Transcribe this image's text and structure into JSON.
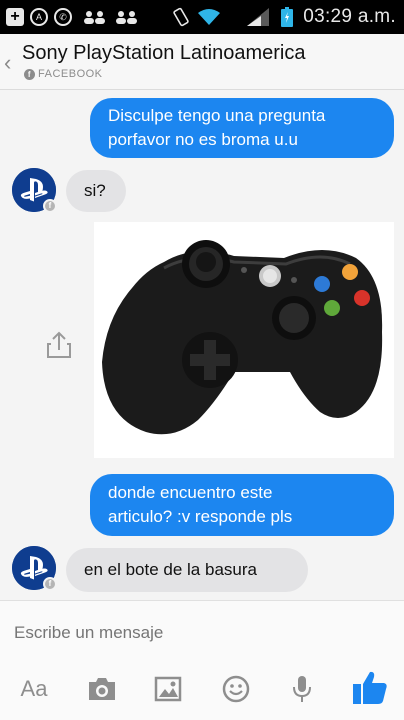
{
  "status_bar": {
    "time": "03:29 a.m."
  },
  "header": {
    "back_icon": "chevron-left-icon",
    "title": "Sony PlayStation Latinoamerica",
    "subtitle": "FACEBOOK"
  },
  "messages": [
    {
      "from": "me",
      "lines": [
        "Disculpe tengo una pregunta",
        "porfavor no es broma u.u"
      ]
    },
    {
      "from": "page",
      "lines": [
        "si?"
      ]
    },
    {
      "from": "me",
      "type": "image",
      "image": "xbox-360-controller-photo"
    },
    {
      "from": "me",
      "lines": [
        "donde encuentro este",
        "articulo? :v responde pls"
      ]
    },
    {
      "from": "page",
      "lines": [
        "en el bote de la basura"
      ]
    }
  ],
  "composer": {
    "placeholder": "Escribe un mensaje",
    "text_button": "Aa",
    "icons": [
      "camera-icon",
      "gallery-icon",
      "emoji-icon",
      "microphone-icon",
      "like-icon"
    ]
  },
  "colors": {
    "outgoing": "#1c86f0",
    "incoming": "#e3e3e5",
    "like": "#1c86f0"
  }
}
